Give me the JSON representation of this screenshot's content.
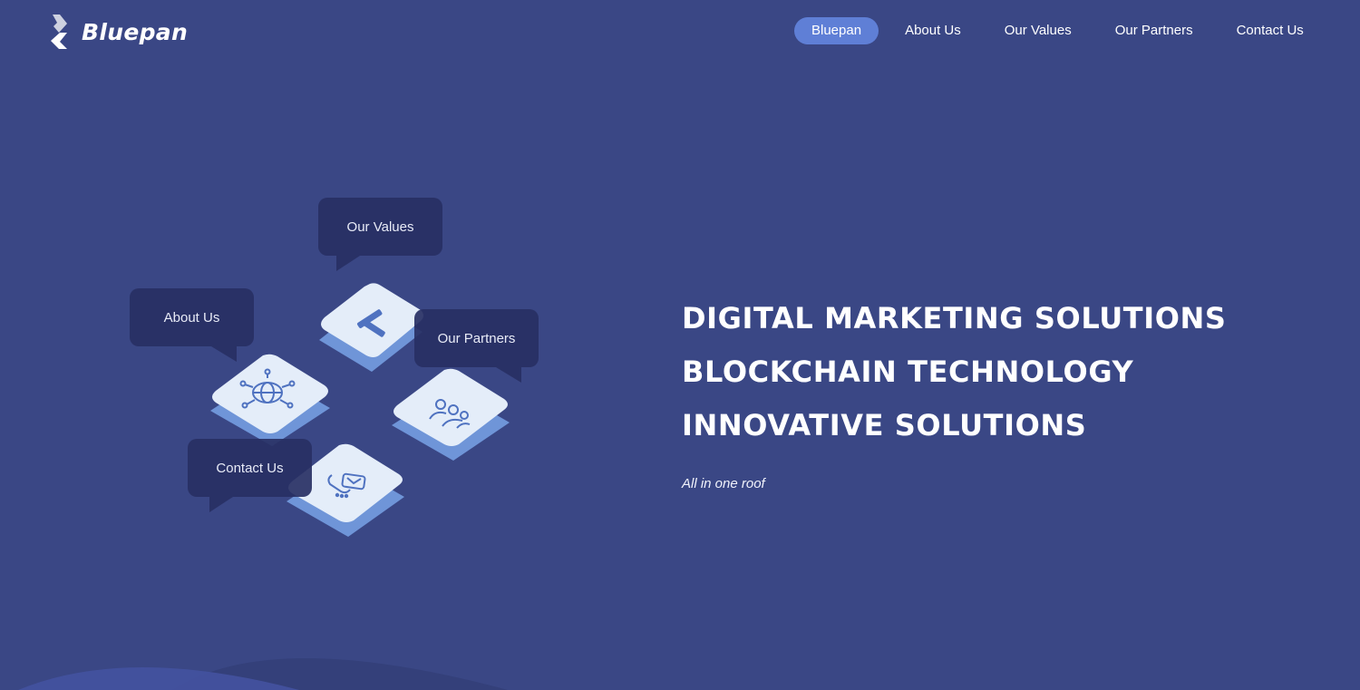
{
  "brand": {
    "name": "Bluepan",
    "logo_icon": "bluepan-logo-icon"
  },
  "nav": {
    "items": [
      {
        "label": "Bluepan",
        "active": true
      },
      {
        "label": "About Us",
        "active": false
      },
      {
        "label": "Our Values",
        "active": false
      },
      {
        "label": "Our Partners",
        "active": false
      },
      {
        "label": "Contact Us",
        "active": false
      }
    ]
  },
  "illustration": {
    "bubbles": {
      "values": "Our Values",
      "about": "About Us",
      "partners": "Our Partners",
      "contact": "Contact Us"
    },
    "tile_icons": [
      "values-icon",
      "globe-network-icon",
      "partners-group-icon",
      "phone-icon"
    ]
  },
  "hero": {
    "lines": [
      "DIGITAL MARKETING SOLUTIONS",
      "BLOCKCHAIN TECHNOLOGY",
      "INNOVATIVE SOLUTIONS"
    ],
    "tagline": "All in one roof"
  },
  "colors": {
    "background": "#3a4785",
    "nav_active": "#5f7fd6",
    "tile_top": "#e4edf9",
    "tile_side": "#6f95d8",
    "bubble": "#283064",
    "icon_stroke": "#4f72c0"
  }
}
